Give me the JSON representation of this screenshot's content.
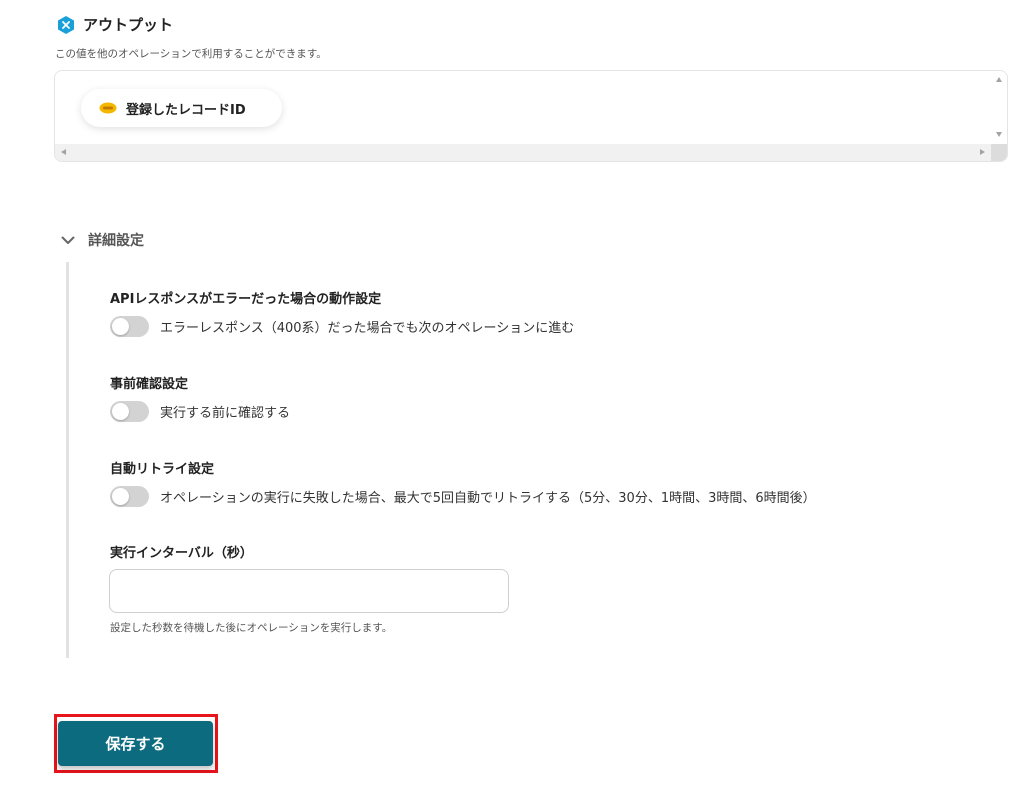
{
  "output": {
    "title": "アウトプット",
    "description": "この値を他のオペレーションで利用することができます。",
    "items": [
      {
        "label": "登録したレコードID",
        "icon": "database-icon"
      }
    ]
  },
  "advanced": {
    "label": "詳細設定",
    "expanded": true,
    "settings": [
      {
        "title": "APIレスポンスがエラーだった場合の動作設定",
        "toggle_label": "エラーレスポンス（400系）だった場合でも次のオペレーションに進む",
        "enabled": false
      },
      {
        "title": "事前確認設定",
        "toggle_label": "実行する前に確認する",
        "enabled": false
      },
      {
        "title": "自動リトライ設定",
        "toggle_label": "オペレーションの実行に失敗した場合、最大で5回自動でリトライする（5分、30分、1時間、3時間、6時間後）",
        "enabled": false
      }
    ],
    "interval": {
      "title": "実行インターバル（秒）",
      "value": "",
      "placeholder": "",
      "help": "設定した秒数を待機した後にオペレーションを実行します。"
    }
  },
  "save_button": {
    "label": "保存する"
  },
  "colors": {
    "accent": "#0d6b80",
    "highlight": "#e8141b",
    "output_icon": "#1aa0d8",
    "toggle_off": "#d3d3d3"
  }
}
